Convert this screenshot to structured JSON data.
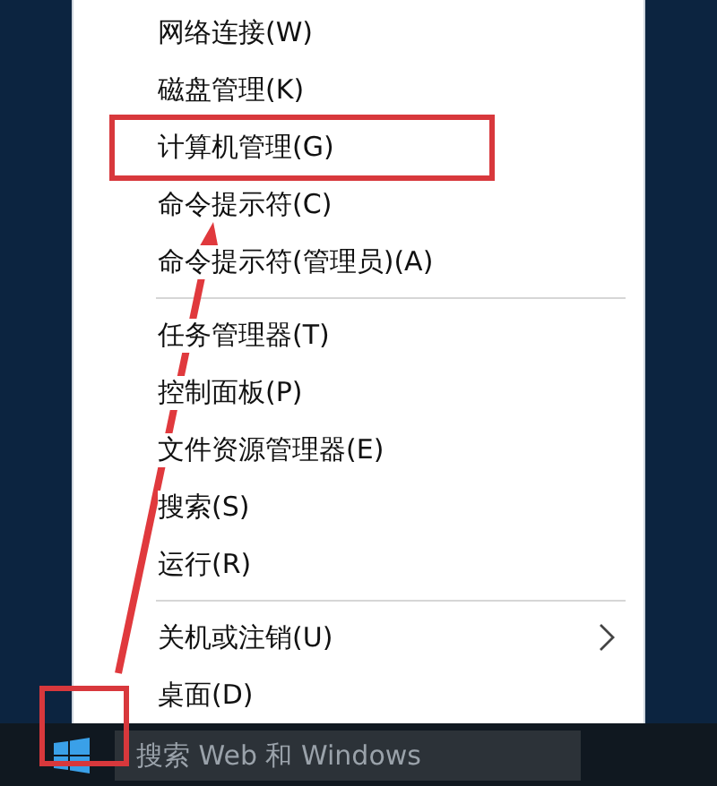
{
  "menu": {
    "items": [
      {
        "kind": "item",
        "label": "网络连接(W)",
        "has_submenu": false,
        "marked": false
      },
      {
        "kind": "item",
        "label": "磁盘管理(K)",
        "has_submenu": false,
        "marked": false
      },
      {
        "kind": "item",
        "label": "计算机管理(G)",
        "has_submenu": false,
        "marked": true
      },
      {
        "kind": "item",
        "label": "命令提示符(C)",
        "has_submenu": false,
        "marked": false
      },
      {
        "kind": "item",
        "label": "命令提示符(管理员)(A)",
        "has_submenu": false,
        "marked": false
      },
      {
        "kind": "separator"
      },
      {
        "kind": "item",
        "label": "任务管理器(T)",
        "has_submenu": false,
        "marked": false
      },
      {
        "kind": "item",
        "label": "控制面板(P)",
        "has_submenu": false,
        "marked": false
      },
      {
        "kind": "item",
        "label": "文件资源管理器(E)",
        "has_submenu": false,
        "marked": false
      },
      {
        "kind": "item",
        "label": "搜索(S)",
        "has_submenu": false,
        "marked": false
      },
      {
        "kind": "item",
        "label": "运行(R)",
        "has_submenu": false,
        "marked": false
      },
      {
        "kind": "separator"
      },
      {
        "kind": "item",
        "label": "关机或注销(U)",
        "has_submenu": true,
        "marked": false
      },
      {
        "kind": "item",
        "label": "桌面(D)",
        "has_submenu": false,
        "marked": false
      }
    ]
  },
  "taskbar": {
    "start_marked": true,
    "search": {
      "placeholder": "搜索 Web 和 Windows"
    }
  }
}
